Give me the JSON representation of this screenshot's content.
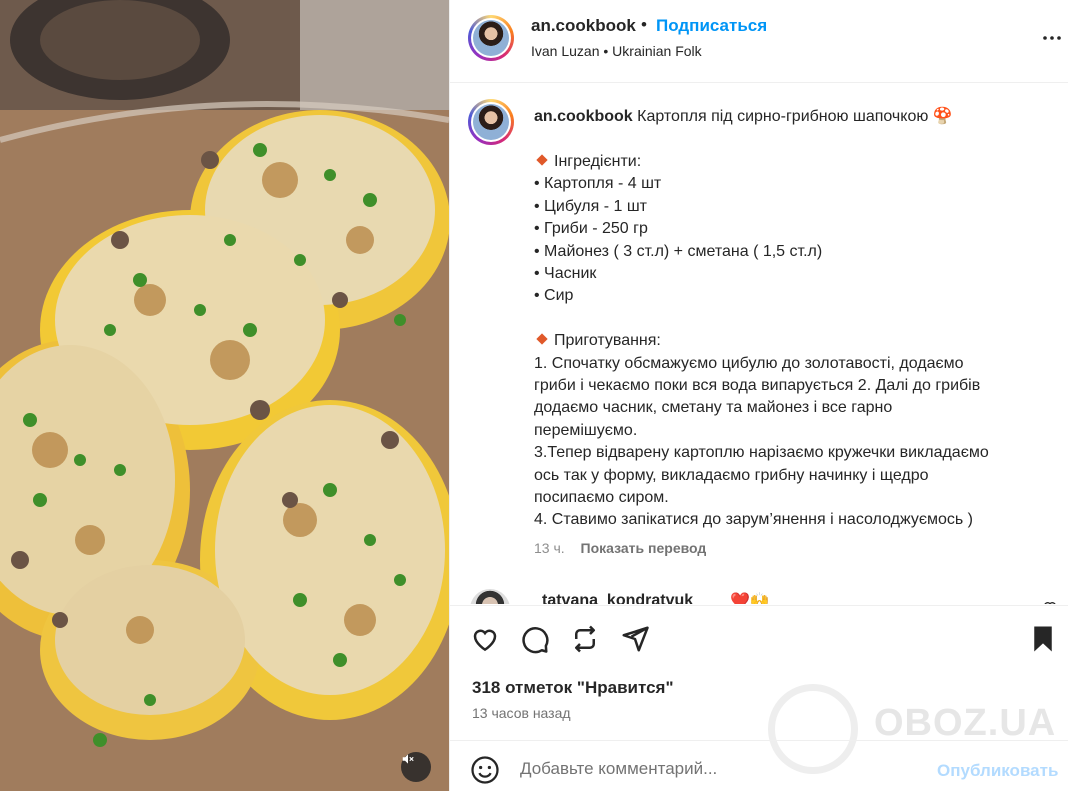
{
  "post_media": {
    "alt": "",
    "mute_icon": "speaker-muted-icon"
  },
  "header": {
    "username": "an.cookbook",
    "separator": "•",
    "follow_label": "Подписаться",
    "audio": "Ivan Luzan • Ukrainian Folk",
    "more_icon": "more-horizontal-icon"
  },
  "caption": {
    "username": "an.cookbook",
    "title": "Картопля під сирно-грибною шапочкою 🍄",
    "lines": [
      "",
      "Інгредієнти:",
      "• Картопля - 4 шт",
      "• Цибуля - 1 шт",
      "• Гриби - 250 гр",
      "• Майонез ( 3 ст.л) + сметана ( 1,5 ст.л)",
      "• Часник",
      "• Сир",
      "",
      "Приготування:",
      "1. Спочатку обсмажуємо цибулю до золотавості, додаємо",
      "гриби і чекаємо поки вся вода випарується 2. Далі до грибів",
      "додаємо часник, сметану та майонез і все гарно",
      "перемішуємо.",
      "3.Тепер відварену картоплю нарізаємо кружечки викладаємо",
      "ось так у форму, викладаємо грибну начинку і щедро",
      "посипаємо сиром.",
      "4. Ставимо запікатися до зарум’янення і насолоджуємось )"
    ],
    "time": "13 ч.",
    "translate_label": "Показать перевод"
  },
  "first_comment": {
    "username": "tatvana_kondratvuk",
    "text": "❤️🙌"
  },
  "actions": {
    "likes": "318 отметок \"Нравится\"",
    "posted_ago": "13 часов назад"
  },
  "watermark": "OBOZ.UA",
  "comment_box": {
    "placeholder": "Добавьте комментарий...",
    "publish_label": "Опубликовать"
  },
  "colors": {
    "accent": "#0095f6",
    "publish_disabled": "#b3dbff",
    "diamond": "#e0592a"
  }
}
